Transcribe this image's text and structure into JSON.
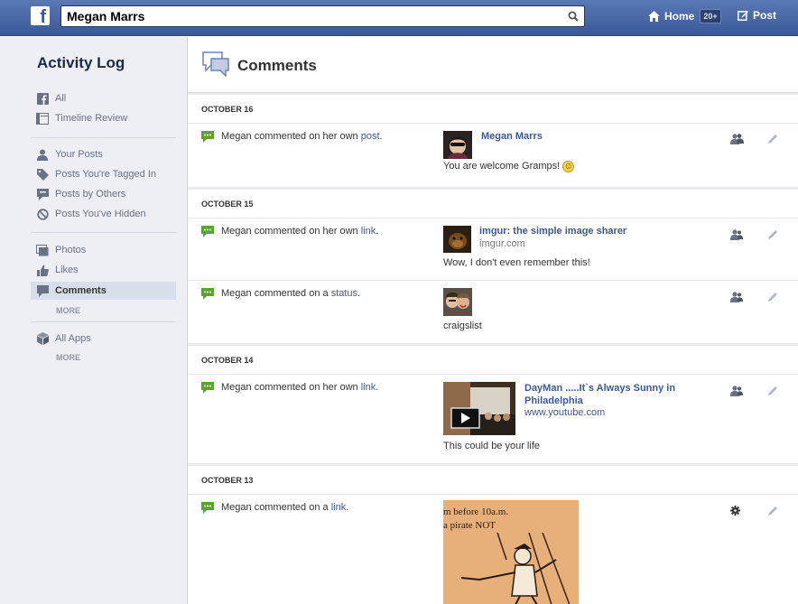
{
  "topbar": {
    "logo": "f",
    "search": {
      "value": "Megan Marrs",
      "placeholder": ""
    },
    "home_label": "Home",
    "home_count": "20+",
    "post_label": "Post"
  },
  "sidebar": {
    "title": "Activity Log",
    "groups": [
      [
        {
          "label": "All",
          "icon": "facebook-icon"
        },
        {
          "label": "Timeline Review",
          "icon": "timeline-icon"
        }
      ],
      [
        {
          "label": "Your Posts",
          "icon": "person-icon"
        },
        {
          "label": "Posts You're Tagged In",
          "icon": "tag-icon"
        },
        {
          "label": "Posts by Others",
          "icon": "speech-icon"
        },
        {
          "label": "Posts You've Hidden",
          "icon": "hidden-icon"
        }
      ],
      [
        {
          "label": "Photos",
          "icon": "photos-icon"
        },
        {
          "label": "Likes",
          "icon": "thumbs-up-icon"
        },
        {
          "label": "Comments",
          "icon": "comment-icon",
          "active": true
        }
      ],
      [
        {
          "label": "All Apps",
          "icon": "cube-icon"
        }
      ]
    ],
    "more_label": "MORE"
  },
  "main": {
    "title": "Comments",
    "dates": [
      "OCTOBER 16",
      "OCTOBER 15",
      "OCTOBER 14",
      "OCTOBER 13"
    ],
    "entries": [
      {
        "pre": "Megan commented on her own ",
        "link": "post",
        "post": ".",
        "title": "Megan Marrs",
        "sub": "",
        "comment": "You are welcome Gramps!",
        "emoji": "☺"
      },
      {
        "pre": "Megan commented on her own ",
        "link": "link",
        "post": ".",
        "title": "imgur: the simple image sharer",
        "sub": "imgur.com",
        "comment": "Wow, I don't even remember this!",
        "emoji": ""
      },
      {
        "pre": "Megan commented on a ",
        "link": "status",
        "post": ".",
        "title": "",
        "sub": "",
        "comment": "craigslist",
        "emoji": ""
      },
      {
        "pre": "Megan commented on her own ",
        "link": "link",
        "post": ".",
        "title": "DayMan .....It`s Always Sunny in Philadelphia",
        "sub": "www.youtube.com",
        "comment": "This could be your life",
        "emoji": ""
      },
      {
        "pre": "Megan commented on a ",
        "link": "link",
        "post": ".",
        "title": "",
        "sub": "",
        "comment": "",
        "emoji": "",
        "image_text": [
          "m before 10a.m.",
          "a pirate NOT"
        ]
      }
    ]
  },
  "colors": {
    "brand": "#3b5998",
    "comment_icon": "#5fa033",
    "sidebar_bg": "#edeff4"
  }
}
